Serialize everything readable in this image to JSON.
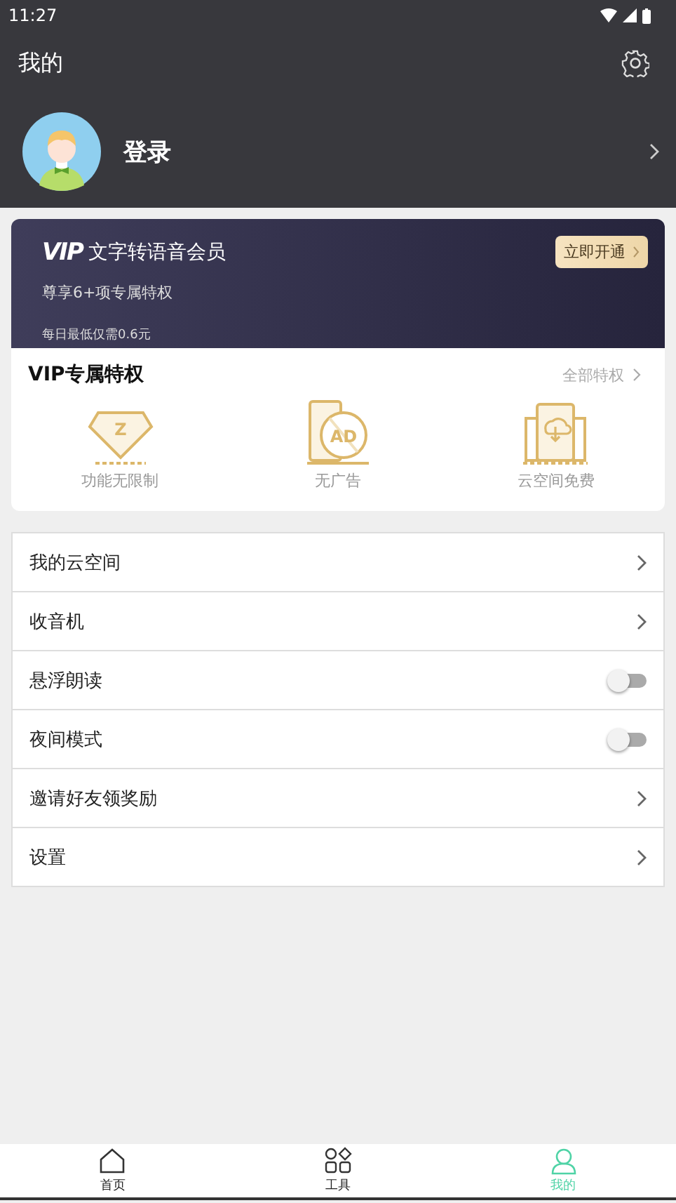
{
  "status_bar": {
    "time": "11:27"
  },
  "header": {
    "title": "我的"
  },
  "profile": {
    "login": "登录"
  },
  "vip": {
    "logo": "VIP",
    "title": "文字转语音会员",
    "button": "立即开通",
    "subtitle": "尊享6+项专属特权",
    "price": "每日最低仅需0.6元",
    "section_title": "VIP专属特权",
    "all_link": "全部特权",
    "perks": [
      {
        "kind": "unlimited",
        "icon_text": "Z",
        "label": "功能无限制"
      },
      {
        "kind": "noads",
        "icon_text": "AD",
        "label": "无广告"
      },
      {
        "kind": "cloud",
        "label": "云空间免费"
      }
    ]
  },
  "menu": [
    {
      "kind": "link",
      "label": "我的云空间"
    },
    {
      "kind": "link",
      "label": "收音机"
    },
    {
      "kind": "toggle",
      "label": "悬浮朗读",
      "on": false
    },
    {
      "kind": "toggle",
      "label": "夜间模式",
      "on": false
    },
    {
      "kind": "link",
      "label": "邀请好友领奖励"
    },
    {
      "kind": "link",
      "label": "设置"
    }
  ],
  "bottom_nav": [
    {
      "kind": "home",
      "label": "首页",
      "selected": false
    },
    {
      "kind": "tools",
      "label": "工具",
      "selected": false
    },
    {
      "kind": "me",
      "label": "我的",
      "selected": true
    }
  ]
}
